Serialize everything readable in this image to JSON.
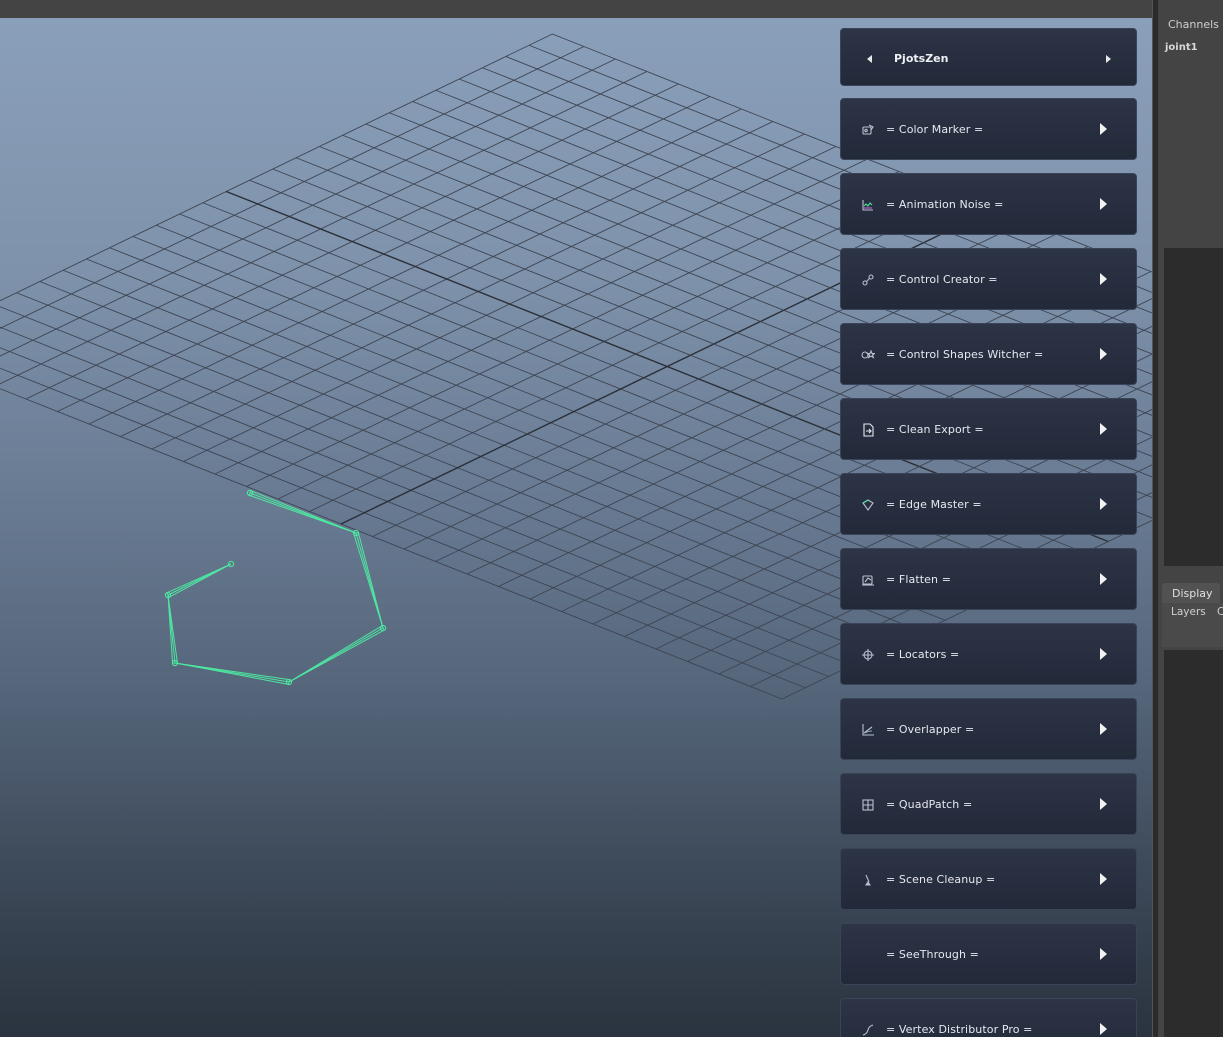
{
  "panel": {
    "title": "PjotsZen",
    "tools": [
      {
        "label": "= Color Marker =",
        "icon": "color-marker-icon"
      },
      {
        "label": "= Animation Noise =",
        "icon": "animation-noise-icon"
      },
      {
        "label": "= Control Creator =",
        "icon": "control-creator-icon"
      },
      {
        "label": "= Control Shapes Witcher =",
        "icon": "control-shapes-icon"
      },
      {
        "label": "= Clean Export =",
        "icon": "clean-export-icon"
      },
      {
        "label": "= Edge Master =",
        "icon": "edge-master-icon"
      },
      {
        "label": "= Flatten =",
        "icon": "flatten-icon"
      },
      {
        "label": "= Locators =",
        "icon": "locator-crosshair-icon"
      },
      {
        "label": "= Overlapper =",
        "icon": "overlapper-icon"
      },
      {
        "label": "= QuadPatch =",
        "icon": "quadpatch-grid-icon"
      },
      {
        "label": "= Scene Cleanup =",
        "icon": "broom-icon"
      },
      {
        "label": "= SeeThrough =",
        "icon": ""
      },
      {
        "label": "= Vertex Distributor Pro =",
        "icon": "vertex-distributor-icon"
      }
    ]
  },
  "channel_box": {
    "title": "Channels",
    "selected": "joint1"
  },
  "layer_editor": {
    "tab": "Display",
    "menu": [
      "Layers",
      "C"
    ]
  },
  "colors": {
    "joint_wire": "#4ee6a0",
    "card_bg": "#262d3e",
    "grid_line": "#3d4452"
  }
}
